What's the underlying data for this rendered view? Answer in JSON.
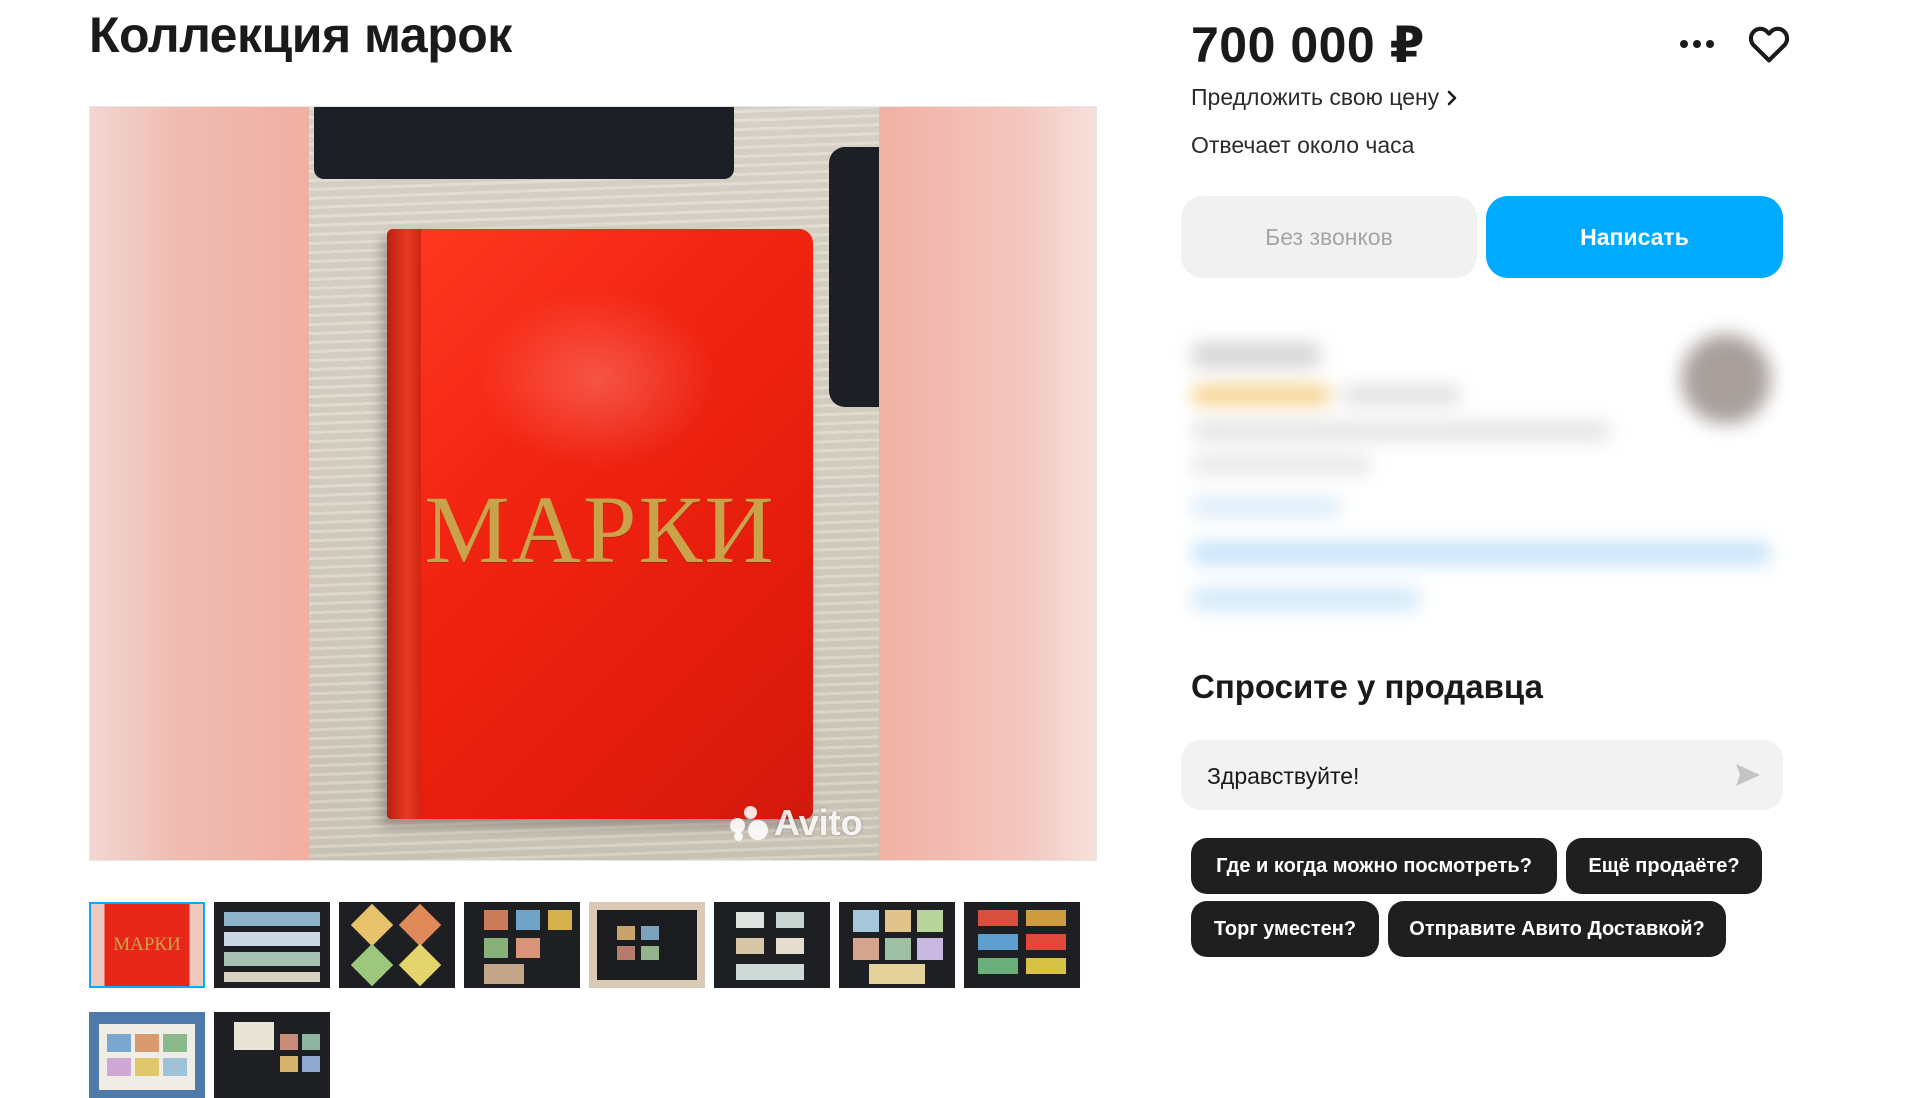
{
  "listing": {
    "title": "Коллекция марок",
    "album_text": "МАРКИ",
    "watermark": "Avito"
  },
  "sidebar": {
    "price": "700 000 ₽",
    "offer_link": "Предложить свою цену",
    "response_time": "Отвечает около часа",
    "no_calls_label": "Без звонков",
    "write_label": "Написать"
  },
  "ask": {
    "heading": "Спросите у продавца",
    "message_value": "Здравствуйте!",
    "chips": [
      "Где и когда можно посмотреть?",
      "Ещё продаёте?",
      "Торг уместен?",
      "Отправите Авито Доставкой?"
    ]
  },
  "thumbnails": {
    "count": 10,
    "active_index": 0,
    "first_label": "МАРКИ"
  },
  "colors": {
    "accent": "#00aaff",
    "chip_bg": "#1f1f1f",
    "album_red": "#f32512"
  },
  "icons": [
    "more-dots-icon",
    "heart-icon",
    "chevron-right-icon",
    "send-icon",
    "avito-logo-icon"
  ]
}
